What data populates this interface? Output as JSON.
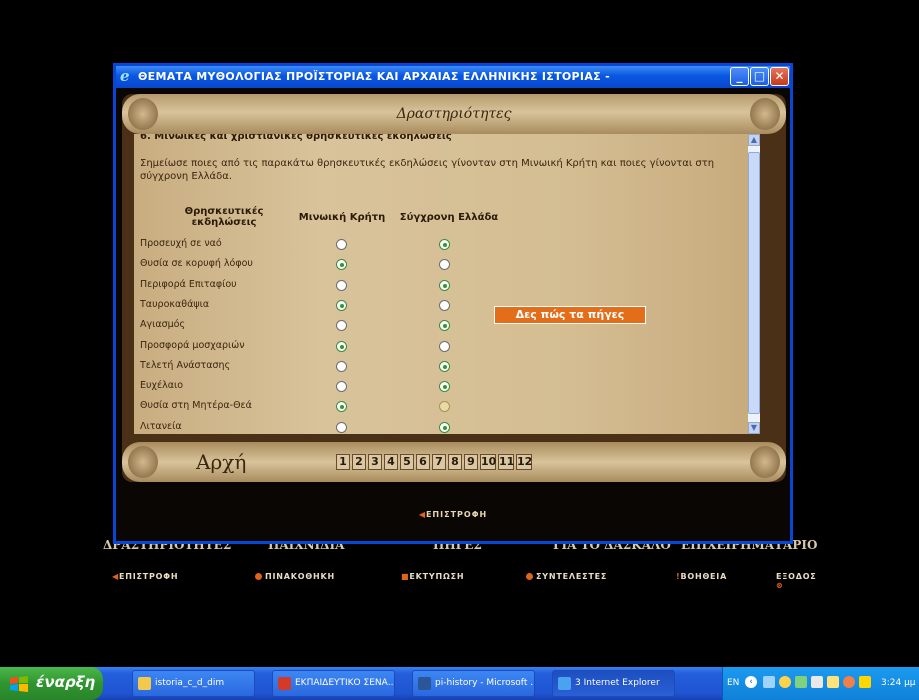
{
  "window": {
    "title": "ΘΕΜΑΤΑ ΜΥΘΟΛΟΓΙΑΣ ΠΡΟΪΣΤΟΡΙΑΣ ΚΑΙ ΑΡΧΑΙΑΣ ΕΛΛΗΝΙΚΗΣ ΙΣΤΟΡΙΑΣ -",
    "minimize": "_",
    "maximize": "□",
    "close": "✕"
  },
  "scroll": {
    "heading": "Δραστηριότητες",
    "section_title": "6. Μινωικές και χριστιανικές θρησκευτικές εκδηλώσεις",
    "instruction": "Σημείωσε ποιες από τις παρακάτω θρησκευτικές εκδηλώσεις γίνονταν στη Μινωική Κρήτη και ποιες γίνονται στη σύγχρονη Ελλάδα.",
    "col_events": "Θρησκευτικές εκδηλώσεις",
    "col_minoan": "Μινωική Κρήτη",
    "col_modern": "Σύγχρονη Ελλάδα",
    "rows": [
      {
        "label": "Προσευχή σε ναό",
        "minoan": false,
        "modern": true
      },
      {
        "label": "Θυσία σε κορυφή λόφου",
        "minoan": true,
        "modern": false
      },
      {
        "label": "Περιφορά Επιταφίου",
        "minoan": false,
        "modern": true
      },
      {
        "label": "Ταυροκαθάψια",
        "minoan": true,
        "modern": false
      },
      {
        "label": "Αγιασμός",
        "minoan": false,
        "modern": true
      },
      {
        "label": "Προσφορά μοσχαριών",
        "minoan": true,
        "modern": false
      },
      {
        "label": "Τελετή Ανάστασης",
        "minoan": false,
        "modern": true
      },
      {
        "label": "Ευχέλαιο",
        "minoan": false,
        "modern": true
      },
      {
        "label": "Θυσία στη Μητέρα-Θεά",
        "minoan": true,
        "modern": false
      },
      {
        "label": "Λιτανεία",
        "minoan": false,
        "modern": true
      }
    ],
    "check_button": "Δες πώς τα πήγες",
    "start_label": "Αρχή",
    "pages": [
      "1",
      "2",
      "3",
      "4",
      "5",
      "6",
      "7",
      "8",
      "9",
      "10",
      "11",
      "12"
    ],
    "back_label": "ΕΠΙΣΤΡΟΦΗ"
  },
  "background_site": {
    "brands": [
      "ΔΡΑΣΤΗΡΙΟΤΗΤΕΣ",
      "ΠΑΙΧΝΙΔΙΑ",
      "ΠΗΓΕΣ",
      "ΓΙΑ ΤΟ ΔΑΣΚΑΛΟ",
      "ΕΠΙΧΕΙΡΗΜΑΤΑΡΙΟ"
    ],
    "nav": [
      "ΕΠΙΣΤΡΟΦΗ",
      "ΠΙΝΑΚΟΘΗΚΗ",
      "ΕΚΤΥΠΩΣΗ",
      "ΣΥΝΤΕΛΕΣΤΕΣ",
      "ΒΟΗΘΕΙΑ",
      "ΕΞΟΔΟΣ"
    ]
  },
  "taskbar": {
    "start": "έναρξη",
    "tasks": [
      {
        "label": "istoria_c_d_dim",
        "icon": "folder-icon",
        "color": "#f2c94c"
      },
      {
        "label": "ΕΚΠΑΙΔΕΥΤΙΚΟ ΣΕΝΑ...",
        "icon": "pdf-icon",
        "color": "#d23b2a"
      },
      {
        "label": "pi-history - Microsoft ...",
        "icon": "word-icon",
        "color": "#2b579a"
      },
      {
        "label": "3 Internet Explorer",
        "icon": "ie-icon",
        "color": "#4aa3f0"
      }
    ],
    "tray_lang": "EN",
    "clock": "3:24 μμ"
  },
  "colors": {
    "titlebar": "#0a57e0",
    "check_button": "#e46d1a",
    "radio_selected": "#2c9a2c",
    "parchment": "#d9c39b"
  }
}
